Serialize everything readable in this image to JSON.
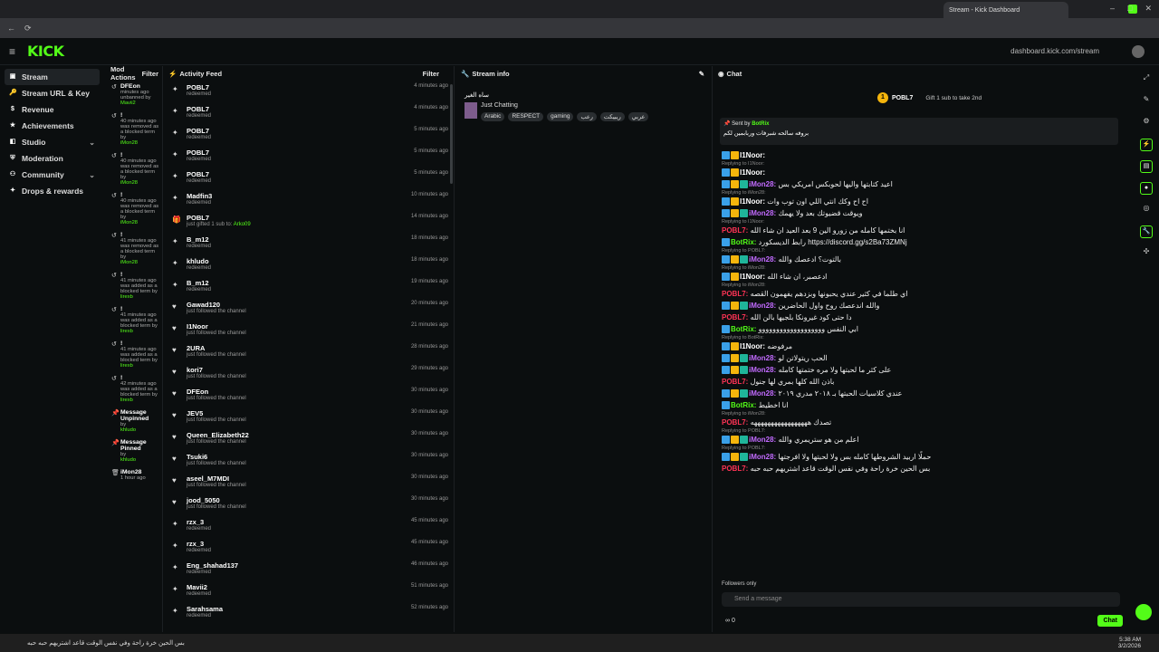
{
  "browser": {
    "tab_title": "Stream - Kick Dashboard",
    "url": "dashboard.kick.com/stream"
  },
  "sidebar": {
    "items": [
      {
        "label": "Stream",
        "icon": "stream-icon"
      },
      {
        "label": "Stream URL & Key",
        "icon": "key-icon"
      },
      {
        "label": "Revenue",
        "icon": "revenue-icon"
      },
      {
        "label": "Achievements",
        "icon": "trophy-icon"
      },
      {
        "label": "Studio",
        "icon": "studio-icon"
      },
      {
        "label": "Moderation",
        "icon": "shield-icon"
      },
      {
        "label": "Community",
        "icon": "community-icon"
      },
      {
        "label": "Drops & rewards",
        "icon": "gift-icon"
      }
    ]
  },
  "modactions": {
    "title": "Mod Actions",
    "filter": "Filter",
    "items": [
      {
        "icon": "undo-icon",
        "name": "DFEon",
        "time": "minutes ago",
        "text": "unbanned by",
        "who": "Mavii2"
      },
      {
        "icon": "undo-icon",
        "name": "!",
        "time": "40 minutes ago",
        "text": "was removed as a blocked term by",
        "who": "iMon28"
      },
      {
        "icon": "undo-icon",
        "name": "!",
        "time": "40 minutes ago",
        "text": "was removed as a blocked term by",
        "who": "iMon28"
      },
      {
        "icon": "undo-icon",
        "name": "!",
        "time": "40 minutes ago",
        "text": "was removed as a blocked term by",
        "who": "iMon28"
      },
      {
        "icon": "undo-icon",
        "name": "!",
        "time": "41 minutes ago",
        "text": "was removed as a blocked term by",
        "who": "iMon28"
      },
      {
        "icon": "undo-icon",
        "name": "!",
        "time": "41 minutes ago",
        "text": "was added as a blocked term by",
        "who": "lirexb"
      },
      {
        "icon": "undo-icon",
        "name": "!",
        "time": "41 minutes ago",
        "text": "was added as a blocked term by",
        "who": "lirexb"
      },
      {
        "icon": "undo-icon",
        "name": "!",
        "time": "41 minutes ago",
        "text": "was added as a blocked term by",
        "who": "lirexb"
      },
      {
        "icon": "undo-icon",
        "name": "!",
        "time": "42 minutes ago",
        "text": "was added as a blocked term by",
        "who": "lirexb"
      },
      {
        "icon": "pin-icon",
        "name": "Message Unpinned",
        "time": "",
        "text": "by",
        "who": "khludo"
      },
      {
        "icon": "pin-icon",
        "name": "Message Pinned",
        "time": "",
        "text": "by",
        "who": "khludo"
      },
      {
        "icon": "trash-icon",
        "name": "iMon28",
        "time": "1 hour ago",
        "text": "",
        "who": ""
      }
    ]
  },
  "activity": {
    "title": "Activity Feed",
    "filter": "Filter",
    "rows": [
      {
        "icon": "redeem-icon",
        "name": "POBL7",
        "sub": "redeemed",
        "extra": "",
        "time": "4 minutes ago"
      },
      {
        "icon": "redeem-icon",
        "name": "POBL7",
        "sub": "redeemed",
        "extra": "",
        "time": "4 minutes ago"
      },
      {
        "icon": "redeem-icon",
        "name": "POBL7",
        "sub": "redeemed",
        "extra": "",
        "time": "5 minutes ago"
      },
      {
        "icon": "redeem-icon",
        "name": "POBL7",
        "sub": "redeemed",
        "extra": "",
        "time": "5 minutes ago"
      },
      {
        "icon": "redeem-icon",
        "name": "POBL7",
        "sub": "redeemed",
        "extra": "",
        "time": "5 minutes ago"
      },
      {
        "icon": "redeem-icon",
        "name": "Madfin3",
        "sub": "redeemed",
        "extra": "",
        "time": "10 minutes ago"
      },
      {
        "icon": "gift-icon",
        "name": "POBL7",
        "sub": "just gifted 1 sub to:",
        "extra": "Arko09",
        "time": "14 minutes ago"
      },
      {
        "icon": "redeem-icon",
        "name": "B_m12",
        "sub": "redeemed",
        "extra": "",
        "time": "18 minutes ago"
      },
      {
        "icon": "redeem-icon",
        "name": "khludo",
        "sub": "redeemed",
        "extra": "",
        "time": "18 minutes ago"
      },
      {
        "icon": "redeem-icon",
        "name": "B_m12",
        "sub": "redeemed",
        "extra": "",
        "time": "19 minutes ago"
      },
      {
        "icon": "heart-icon",
        "name": "Gawad120",
        "sub": "just followed the channel",
        "extra": "",
        "time": "20 minutes ago"
      },
      {
        "icon": "heart-icon",
        "name": "I1Noor",
        "sub": "just followed the channel",
        "extra": "",
        "time": "21 minutes ago"
      },
      {
        "icon": "heart-icon",
        "name": "2URA",
        "sub": "just followed the channel",
        "extra": "",
        "time": "28 minutes ago"
      },
      {
        "icon": "heart-icon",
        "name": "kori7",
        "sub": "just followed the channel",
        "extra": "",
        "time": "29 minutes ago"
      },
      {
        "icon": "heart-icon",
        "name": "DFEon",
        "sub": "just followed the channel",
        "extra": "",
        "time": "30 minutes ago"
      },
      {
        "icon": "heart-icon",
        "name": "JEV5",
        "sub": "just followed the channel",
        "extra": "",
        "time": "30 minutes ago"
      },
      {
        "icon": "heart-icon",
        "name": "Queen_Elizabeth22",
        "sub": "just followed the channel",
        "extra": "",
        "time": "30 minutes ago"
      },
      {
        "icon": "heart-icon",
        "name": "Tsuki6",
        "sub": "just followed the channel",
        "extra": "",
        "time": "30 minutes ago"
      },
      {
        "icon": "heart-icon",
        "name": "aseel_M7MDI",
        "sub": "just followed the channel",
        "extra": "",
        "time": "30 minutes ago"
      },
      {
        "icon": "heart-icon",
        "name": "jood_5050",
        "sub": "just followed the channel",
        "extra": "",
        "time": "30 minutes ago"
      },
      {
        "icon": "redeem-icon",
        "name": "rzx_3",
        "sub": "redeemed",
        "extra": "",
        "time": "45 minutes ago"
      },
      {
        "icon": "redeem-icon",
        "name": "rzx_3",
        "sub": "redeemed",
        "extra": "",
        "time": "45 minutes ago"
      },
      {
        "icon": "redeem-icon",
        "name": "Eng_shahad137",
        "sub": "redeemed",
        "extra": "",
        "time": "46 minutes ago"
      },
      {
        "icon": "redeem-icon",
        "name": "Mavii2",
        "sub": "redeemed",
        "extra": "",
        "time": "51 minutes ago"
      },
      {
        "icon": "redeem-icon",
        "name": "Sarahsama",
        "sub": "redeemed",
        "extra": "",
        "time": "52 minutes ago"
      }
    ]
  },
  "streaminfo": {
    "title": "Stream info",
    "stream_title": "ساه الغير",
    "category": "Just Chatting",
    "tags": [
      "Arabic",
      "RESPECT",
      "gaming",
      "رعب",
      "ريبيكت",
      "عربي"
    ]
  },
  "chat": {
    "title": "Chat",
    "top_user": "POBL7",
    "top_count": "1",
    "gift_text": "Gift 1 sub to take 2nd",
    "pinned_by": "Sent by",
    "pinned_user": "BotRix",
    "pinned_text": "بروفه سالحه شبرفات وربابمين لكم",
    "messages": [
      {
        "reply": "",
        "user": "I1Noor",
        "color": "white",
        "text": "",
        "badges": 2
      },
      {
        "reply": "Replying to I1Noor:",
        "user": "I1Noor",
        "color": "white",
        "text": "",
        "badges": 2
      },
      {
        "reply": "",
        "user": "iMon28",
        "color": "purple",
        "text": "اعيد كتابتها واليها لحوبكس امريكي بس",
        "badges": 3
      },
      {
        "reply": "Replying to iMon28:",
        "user": "I1Noor",
        "color": "white",
        "text": "اح اح وكك انتي اللي اون توب وات",
        "badges": 2
      },
      {
        "reply": "",
        "user": "iMon28",
        "color": "purple",
        "text": "ويوقت قضيوتك بعد ولا يهمك",
        "badges": 3
      },
      {
        "reply": "Replying to I1Noor:",
        "user": "POBL7",
        "color": "red",
        "text": "انا بختمها كامله من زورو الين 9 بعد العيد ان شاء الله",
        "badges": 0
      },
      {
        "reply": "",
        "user": "BotRix",
        "color": "green",
        "text": "رابط الديسكورد https://discord.gg/s2Ba73ZMNj",
        "badges": 1
      },
      {
        "reply": "Replying to POBL7:",
        "user": "iMon28",
        "color": "purple",
        "text": "بالتوت؟ ادعصك والله",
        "badges": 3
      },
      {
        "reply": "Replying to iMon28:",
        "user": "I1Noor",
        "color": "white",
        "text": "ادعصبر، ان شاء الله",
        "badges": 2
      },
      {
        "reply": "Replying to iMon28:",
        "user": "POBL7",
        "color": "red",
        "text": "اي طلما في كثير عندي يحبونها وبزدهم يفهمون القصه",
        "badges": 0
      },
      {
        "reply": "",
        "user": "iMon28",
        "color": "purple",
        "text": "والله اندعصك روح واول الحاضرين",
        "badges": 3
      },
      {
        "reply": "",
        "user": "POBL7",
        "color": "red",
        "text": "دا حتى كود غيرونكا بلجيها بالن الله",
        "badges": 0
      },
      {
        "reply": "",
        "user": "BotRix",
        "color": "green",
        "text": "ابي النفس ووووووووووووووووووو",
        "badges": 1
      },
      {
        "reply": "Replying to BotRix:",
        "user": "I1Noor",
        "color": "white",
        "text": "مرفوضه",
        "badges": 2
      },
      {
        "reply": "",
        "user": "iMon28",
        "color": "purple",
        "text": "الحب ريتولاتن لو",
        "badges": 3
      },
      {
        "reply": "",
        "user": "iMon28",
        "color": "purple",
        "text": "على كثر ما لحبتها ولا مره ختمتها كامله",
        "badges": 3
      },
      {
        "reply": "",
        "user": "POBL7",
        "color": "red",
        "text": "باذن الله كلها بمري لها جنول",
        "badges": 0
      },
      {
        "reply": "",
        "user": "iMon28",
        "color": "purple",
        "text": "عندي كلاسيات الحبتها بـ ٢٠١٨ مدري ٢٠١٩",
        "badges": 3
      },
      {
        "reply": "",
        "user": "BotRix",
        "color": "green",
        "text": "انا اخطيط",
        "badges": 1
      },
      {
        "reply": "Replying to iMon28:",
        "user": "POBL7",
        "color": "red",
        "text": "تصدك هههههههههههههههههه",
        "badges": 0
      },
      {
        "reply": "Replying to POBL7:",
        "user": "iMon28",
        "color": "purple",
        "text": "اعلم من هو ستريمري والله",
        "badges": 3
      },
      {
        "reply": "Replying to POBL7:",
        "user": "iMon28",
        "color": "purple",
        "text": "حملًا اربيد الشروطها كامله بس ولا لحبتها ولا افرجتها",
        "badges": 3
      },
      {
        "reply": "",
        "user": "POBL7",
        "color": "red",
        "text": "بس الحين خرة راحة وفي نفس الوقت قاعد اشتريهم حبه حبه",
        "badges": 0
      }
    ],
    "followers_only": "Followers only",
    "input_placeholder": "Send a message",
    "send_label": "Chat",
    "viewer_count": "0"
  },
  "taskbar": {
    "ticker": "بس الحين خرة راحة وفي نفس الوقت قاعد اشتريهم حبه حبه",
    "time": "5:38 AM",
    "date": "3/2/2026"
  }
}
